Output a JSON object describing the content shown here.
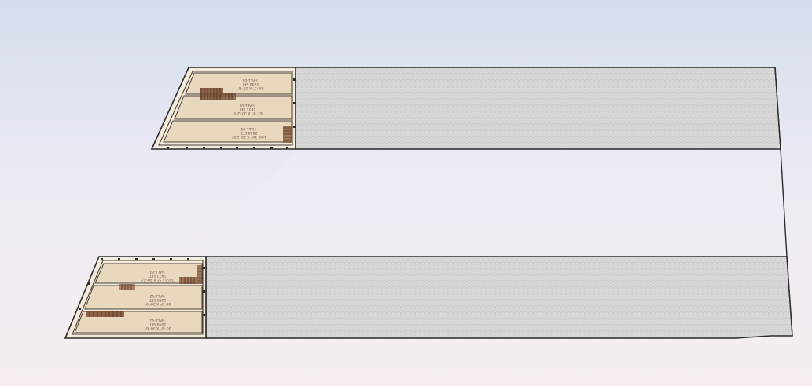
{
  "colors": {
    "outline": "#2b2b2b",
    "hall_fill": "#e8d8be",
    "corridor": "#f4ebdc",
    "wall": "#4a3f35",
    "stair": "#7a4d34",
    "paving": "#d6d6d6",
    "background_top": "#d6dced",
    "background_bottom": "#f6eef0"
  },
  "icons": [
    "staircase-icon",
    "column-marker-icon"
  ],
  "upper_block": {
    "halls": [
      {
        "label_lines": [
          "30'-5\" X 63'-8\"",
          "1940 SFT",
          "HALL-06"
        ]
      },
      {
        "label_lines": [
          "61'-4\" X 30'-2.5\"",
          "1851 SFT",
          "HALL-05"
        ]
      },
      {
        "label_lines": [
          "100'-10\" X 20'-2.5\"",
          "2038 SFT",
          "HALL-04"
        ]
      }
    ]
  },
  "lower_block": {
    "halls": [
      {
        "label_lines": [
          "39'-11.5\" X 30'-5\"",
          "1937 SFT",
          "HALL-03"
        ]
      },
      {
        "label_lines": [
          "46'-3\" X 30'-9\"",
          "1355 SFT",
          "HALL-02"
        ]
      },
      {
        "label_lines": [
          "30'-6\" X 36'-6\"",
          "1048 SFT",
          "HALL-01"
        ]
      }
    ]
  }
}
